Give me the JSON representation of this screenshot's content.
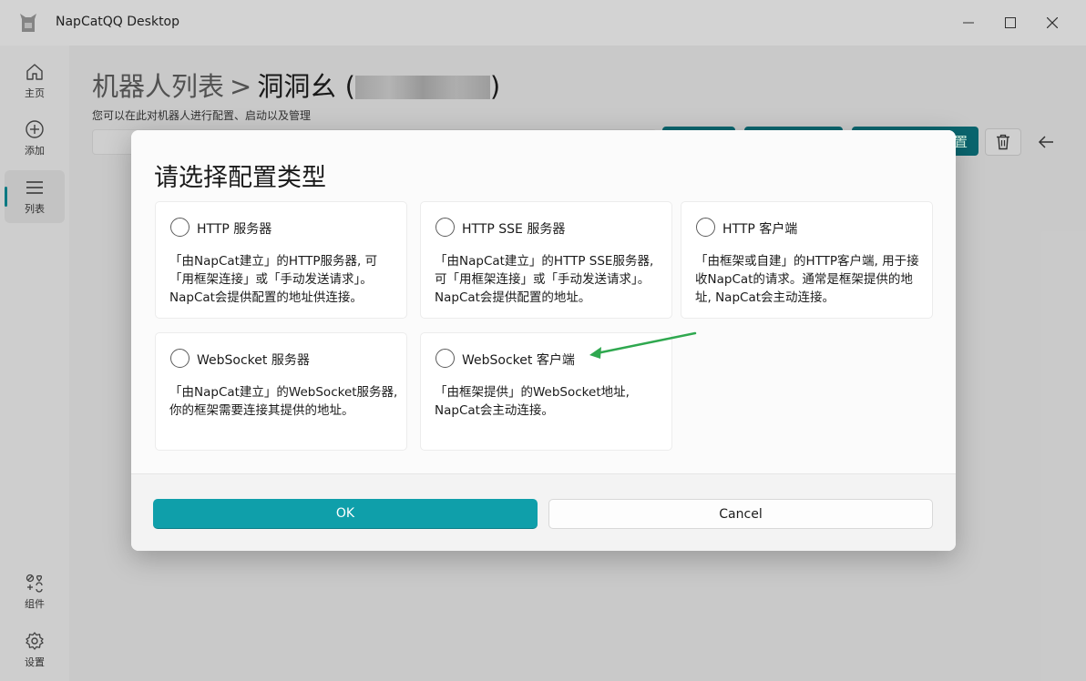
{
  "app": {
    "title": "NapCatQQ Desktop"
  },
  "sidebar": {
    "items": [
      {
        "label": "主页",
        "icon": "home-icon"
      },
      {
        "label": "添加",
        "icon": "add-circle-icon"
      },
      {
        "label": "列表",
        "icon": "list-icon",
        "active": true
      },
      {
        "label": "组件",
        "icon": "components-icon"
      },
      {
        "label": "设置",
        "icon": "gear-icon"
      }
    ]
  },
  "page": {
    "breadcrumb_root": "机器人列表",
    "breadcrumb_separator": ">",
    "bot_name": "洞洞幺",
    "open_paren": "(",
    "close_paren": ")",
    "subtitle": "您可以在此对机器人进行配置、启动以及管理",
    "partial_button_text": "置"
  },
  "dialog": {
    "title": "请选择配置类型",
    "options": [
      {
        "label": "HTTP 服务器",
        "description": "「由NapCat建立」的HTTP服务器, 可「用框架连接」或「手动发送请求」。NapCat会提供配置的地址供连接。",
        "selected": false
      },
      {
        "label": "HTTP SSE 服务器",
        "description": "「由NapCat建立」的HTTP SSE服务器, 可「用框架连接」或「手动发送请求」。NapCat会提供配置的地址。",
        "selected": false
      },
      {
        "label": "HTTP 客户端",
        "description": "「由框架或自建」的HTTP客户端, 用于接收NapCat的请求。通常是框架提供的地址, NapCat会主动连接。",
        "selected": false
      },
      {
        "label": "WebSocket 服务器",
        "description": "「由NapCat建立」的WebSocket服务器, 你的框架需要连接其提供的地址。",
        "selected": false
      },
      {
        "label": "WebSocket 客户端",
        "description": "「由框架提供」的WebSocket地址, NapCat会主动连接。",
        "selected": false
      }
    ],
    "ok_label": "OK",
    "cancel_label": "Cancel"
  },
  "colors": {
    "accent": "#0f9faa",
    "annotation_arrow": "#2fa84f"
  }
}
